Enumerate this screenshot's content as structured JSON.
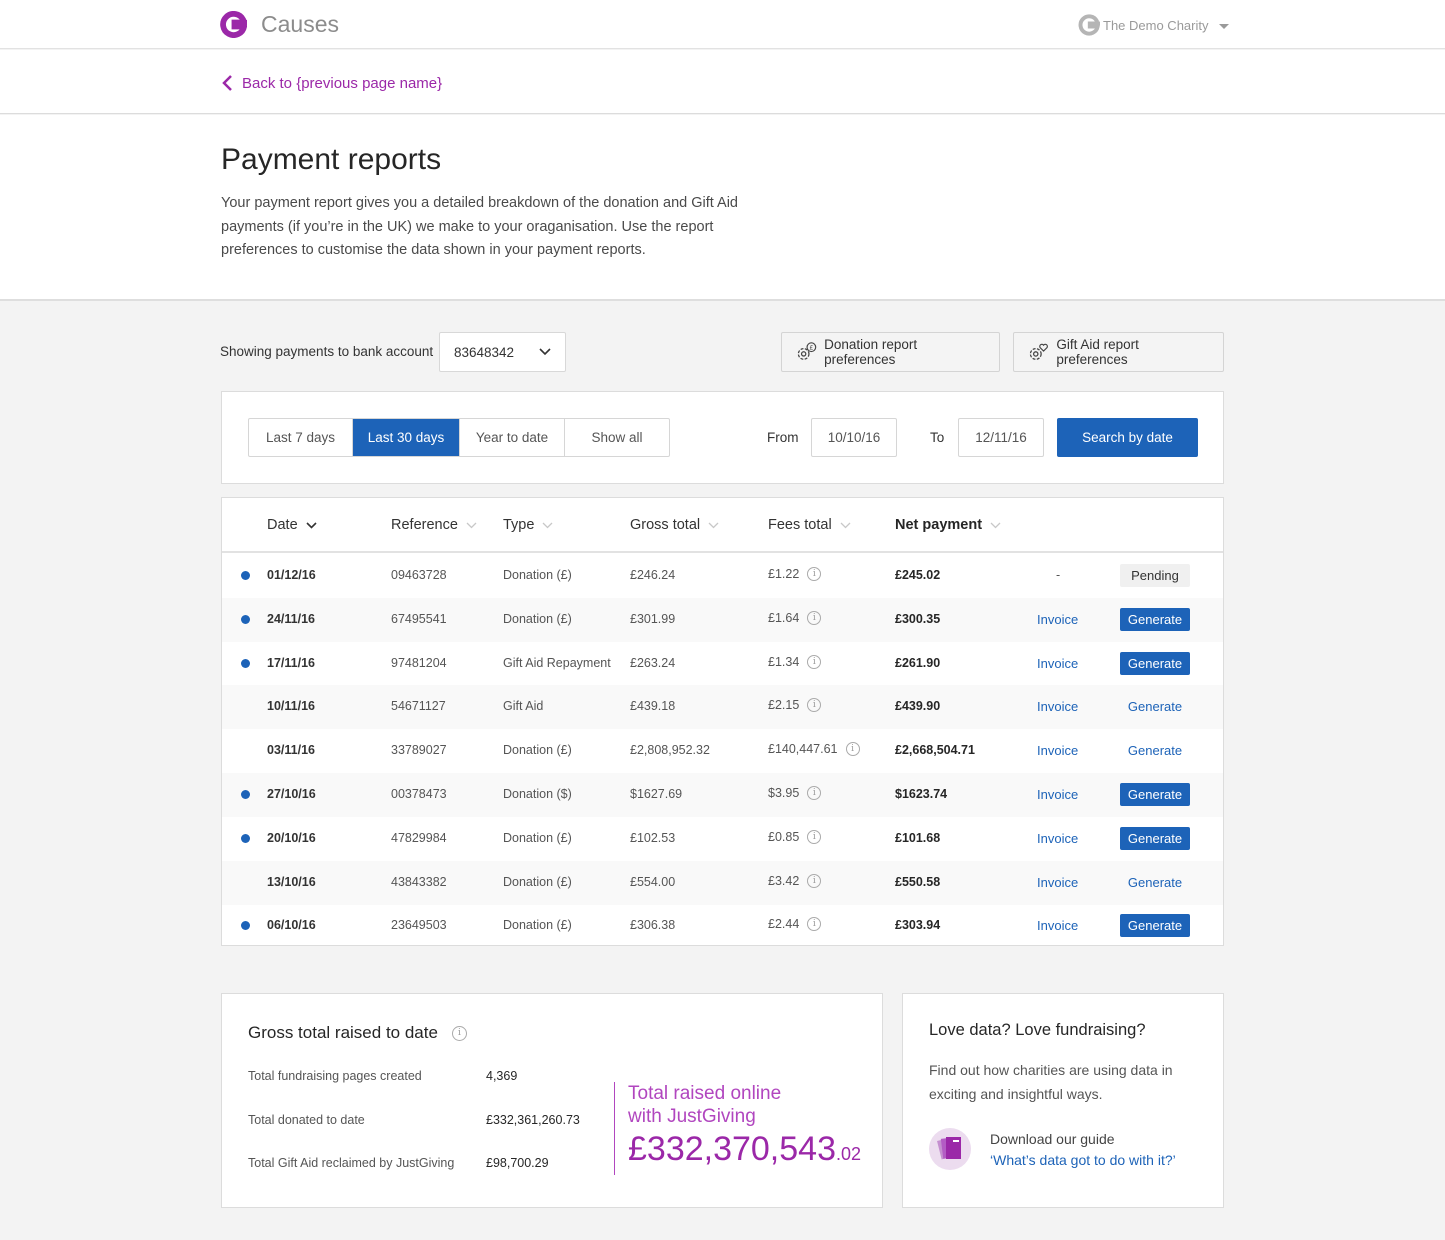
{
  "header": {
    "brand": "Causes",
    "account_name": "The Demo Charity",
    "brand_color": "#9b28a8"
  },
  "back_link": "Back to {previous page name}",
  "page": {
    "title": "Payment reports",
    "description": "Your payment report gives you a detailed breakdown of the donation and Gift Aid payments (if you’re in the UK) we make to your oraganisation. Use the report preferences to customise the data shown in your payment reports."
  },
  "controls": {
    "account_label": "Showing payments to bank account",
    "account_value": "83648342",
    "donation_prefs": "Donation report preferences",
    "giftaid_prefs": "Gift Aid report preferences"
  },
  "filters": {
    "ranges": [
      "Last 7 days",
      "Last 30 days",
      "Year to date",
      "Show all"
    ],
    "active_range": "Last 30 days",
    "from_label": "From",
    "from_value": "10/10/16",
    "to_label": "To",
    "to_value": "12/11/16",
    "search_label": "Search by date"
  },
  "table": {
    "headers": [
      "Date",
      "Reference",
      "Type",
      "Gross total",
      "Fees total",
      "Net payment"
    ],
    "rows": [
      {
        "new": true,
        "date": "01/12/16",
        "ref": "09463728",
        "type": "Donation (£)",
        "gross": "£246.24",
        "fees": "£1.22",
        "net": "£245.02",
        "invoice": "-",
        "action": "Pending",
        "action_style": "pending"
      },
      {
        "new": true,
        "date": "24/11/16",
        "ref": "67495541",
        "type": "Donation (£)",
        "gross": "£301.99",
        "fees": "£1.64",
        "net": "£300.35",
        "invoice": "Invoice",
        "action": "Generate",
        "action_style": "solid"
      },
      {
        "new": true,
        "date": "17/11/16",
        "ref": "97481204",
        "type": "Gift Aid Repayment",
        "gross": "£263.24",
        "fees": "£1.34",
        "net": "£261.90",
        "invoice": "Invoice",
        "action": "Generate",
        "action_style": "solid"
      },
      {
        "new": false,
        "date": "10/11/16",
        "ref": "54671127",
        "type": "Gift Aid",
        "gross": "£439.18",
        "fees": "£2.15",
        "net": "£439.90",
        "invoice": "Invoice",
        "action": "Generate",
        "action_style": "link"
      },
      {
        "new": false,
        "date": "03/11/16",
        "ref": "33789027",
        "type": "Donation (£)",
        "gross": "£2,808,952.32",
        "fees": "£140,447.61",
        "net": "£2,668,504.71",
        "invoice": "Invoice",
        "action": "Generate",
        "action_style": "link"
      },
      {
        "new": true,
        "date": "27/10/16",
        "ref": "00378473",
        "type": "Donation ($)",
        "gross": "$1627.69",
        "fees": "$3.95",
        "net": "$1623.74",
        "invoice": "Invoice",
        "action": "Generate",
        "action_style": "solid"
      },
      {
        "new": true,
        "date": "20/10/16",
        "ref": "47829984",
        "type": "Donation (£)",
        "gross": "£102.53",
        "fees": "£0.85",
        "net": "£101.68",
        "invoice": "Invoice",
        "action": "Generate",
        "action_style": "solid"
      },
      {
        "new": false,
        "date": "13/10/16",
        "ref": "43843382",
        "type": "Donation (£)",
        "gross": "£554.00",
        "fees": "£3.42",
        "net": "£550.58",
        "invoice": "Invoice",
        "action": "Generate",
        "action_style": "link"
      },
      {
        "new": true,
        "date": "06/10/16",
        "ref": "23649503",
        "type": "Donation (£)",
        "gross": "£306.38",
        "fees": "£2.44",
        "net": "£303.94",
        "invoice": "Invoice",
        "action": "Generate",
        "action_style": "solid"
      }
    ]
  },
  "totals": {
    "title": "Gross total raised to date",
    "items": [
      {
        "label": "Total fundraising pages created",
        "value": "4,369"
      },
      {
        "label": "Total donated to date",
        "value": "£332,361,260.73"
      },
      {
        "label": "Total Gift Aid reclaimed by JustGiving",
        "value": "£98,700.29"
      }
    ],
    "online_caption_1": "Total raised online",
    "online_caption_2": "with JustGiving",
    "online_amount": "£332,370,543",
    "online_pence": ".02"
  },
  "promo": {
    "title": "Love data? Love fundraising?",
    "body": "Find out how charities are using data in exciting and insightful ways.",
    "download_label": "Download our guide",
    "guide_link": "‘What’s data got to do with it?’"
  }
}
